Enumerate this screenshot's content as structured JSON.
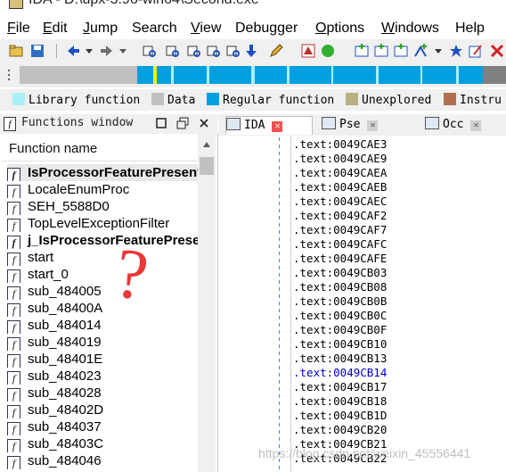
{
  "title": "IDA - D:\\upx-3.96-win64\\Second.exe",
  "menu": [
    {
      "label": "File",
      "u": "F",
      "rest": "ile"
    },
    {
      "label": "Edit",
      "u": "E",
      "rest": "dit"
    },
    {
      "label": "Jump",
      "u": "J",
      "rest": "ump"
    },
    {
      "label": "Search",
      "u": "",
      "rest": "Search"
    },
    {
      "label": "View",
      "u": "V",
      "rest": "iew"
    },
    {
      "label": "Debugger",
      "u": "",
      "rest": "Debugger"
    },
    {
      "label": "Options",
      "u": "O",
      "rest": "ptions"
    },
    {
      "label": "Windows",
      "u": "W",
      "rest": "indows"
    },
    {
      "label": "Help",
      "u": "",
      "rest": "Help"
    }
  ],
  "legend": [
    {
      "label": "Library function",
      "color": "#a8f0f8"
    },
    {
      "label": "Data",
      "color": "#c0c0c0"
    },
    {
      "label": "Regular function",
      "color": "#00a0e0"
    },
    {
      "label": "Unexplored",
      "color": "#b8b080"
    },
    {
      "label": "Instru",
      "color": "#b07050"
    }
  ],
  "functions_window": {
    "title": "Functions window",
    "column_header": "Function name",
    "rows": [
      {
        "name": "IsProcessorFeaturePresent",
        "bold": true,
        "selected": true
      },
      {
        "name": "LocaleEnumProc",
        "bold": false
      },
      {
        "name": "SEH_5588D0",
        "bold": false
      },
      {
        "name": "TopLevelExceptionFilter",
        "bold": false
      },
      {
        "name": "j_IsProcessorFeaturePresent",
        "bold": true
      },
      {
        "name": "start",
        "bold": false
      },
      {
        "name": "start_0",
        "bold": false
      },
      {
        "name": "sub_484005",
        "bold": false
      },
      {
        "name": "sub_48400A",
        "bold": false
      },
      {
        "name": "sub_484014",
        "bold": false
      },
      {
        "name": "sub_484019",
        "bold": false
      },
      {
        "name": "sub_48401E",
        "bold": false
      },
      {
        "name": "sub_484023",
        "bold": false
      },
      {
        "name": "sub_484028",
        "bold": false
      },
      {
        "name": "sub_48402D",
        "bold": false
      },
      {
        "name": "sub_484037",
        "bold": false
      },
      {
        "name": "sub_48403C",
        "bold": false
      },
      {
        "name": "sub_484046",
        "bold": false
      }
    ]
  },
  "annotation": "?",
  "tabs": [
    {
      "label": "IDA",
      "active": true
    },
    {
      "label": "Pse",
      "active": false
    },
    {
      "label": "Occ",
      "active": false
    }
  ],
  "code_lines": [
    ".text:0049CAE3",
    ".text:0049CAE9",
    ".text:0049CAEA",
    ".text:0049CAEB",
    ".text:0049CAEC",
    ".text:0049CAF2",
    ".text:0049CAF7",
    ".text:0049CAFC",
    ".text:0049CAFE",
    ".text:0049CB03",
    ".text:0049CB08",
    ".text:0049CB0B",
    ".text:0049CB0C",
    ".text:0049CB0F",
    ".text:0049CB10",
    ".text:0049CB13",
    ".text:0049CB14",
    ".text:0049CB17",
    ".text:0049CB18",
    ".text:0049CB1D",
    ".text:0049CB20",
    ".text:0049CB21",
    ".text:0049CB22"
  ],
  "highlighted_line": ".text:0049CB14",
  "watermark": "https://blog.csdn.net/weixin_45556441"
}
